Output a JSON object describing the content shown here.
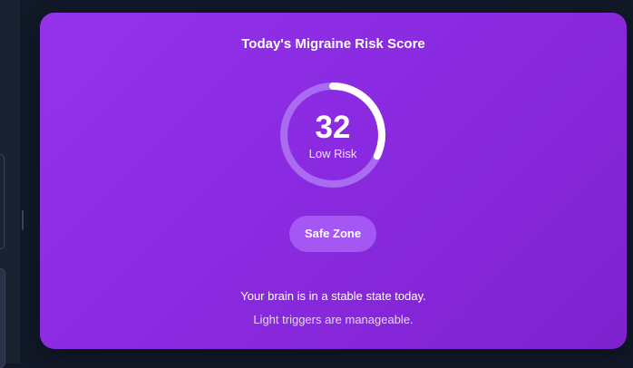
{
  "card": {
    "title": "Today's Migraine Risk Score",
    "score": "32",
    "score_fraction": 0.32,
    "risk_label": "Low Risk",
    "zone_label": "Safe Zone",
    "message_primary": "Your brain is in a stable state today.",
    "message_secondary": "Light triggers are manageable."
  },
  "colors": {
    "card_gradient_start": "#9333ea",
    "card_gradient_end": "#7e22ce",
    "gauge_track": "#a96bf0",
    "gauge_progress": "#ffffff",
    "pill_background": "#a457f2",
    "page_background": "#111827"
  }
}
